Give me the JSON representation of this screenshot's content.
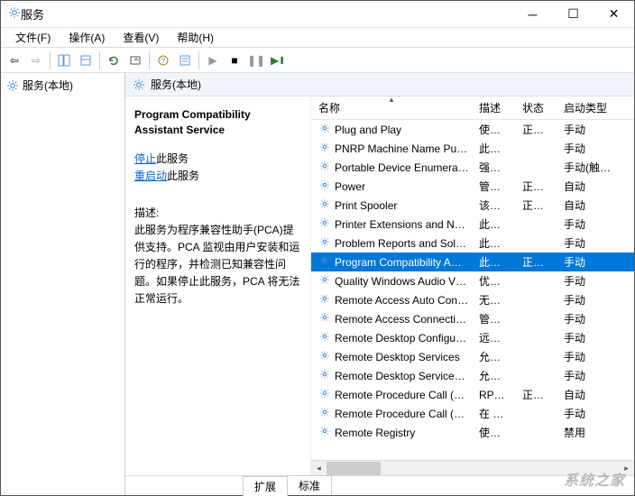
{
  "window": {
    "title": "服务"
  },
  "menu": {
    "file": "文件(F)",
    "action": "操作(A)",
    "view": "查看(V)",
    "help": "帮助(H)"
  },
  "tree": {
    "root": "服务(本地)"
  },
  "right_header": "服务(本地)",
  "detail": {
    "title": "Program Compatibility Assistant Service",
    "stop_link": "停止",
    "stop_suffix": "此服务",
    "restart_link": "重启动",
    "restart_suffix": "此服务",
    "desc_label": "描述:",
    "desc": "此服务为程序兼容性助手(PCA)提供支持。PCA 监视由用户安装和运行的程序，并检测已知兼容性问题。如果停止此服务，PCA 将无法正常运行。"
  },
  "columns": {
    "name": "名称",
    "desc": "描述",
    "status": "状态",
    "startup": "启动类型"
  },
  "rows": [
    {
      "name": "Plug and Play",
      "desc": "使计…",
      "status": "正在…",
      "startup": "手动",
      "selected": false
    },
    {
      "name": "PNRP Machine Name Pu…",
      "desc": "此服…",
      "status": "",
      "startup": "手动",
      "selected": false
    },
    {
      "name": "Portable Device Enumera…",
      "desc": "强制…",
      "status": "",
      "startup": "手动(触发…",
      "selected": false
    },
    {
      "name": "Power",
      "desc": "管理…",
      "status": "正在…",
      "startup": "自动",
      "selected": false
    },
    {
      "name": "Print Spooler",
      "desc": "该服…",
      "status": "正在…",
      "startup": "自动",
      "selected": false
    },
    {
      "name": "Printer Extensions and N…",
      "desc": "此服…",
      "status": "",
      "startup": "手动",
      "selected": false
    },
    {
      "name": "Problem Reports and Sol…",
      "desc": "此服…",
      "status": "",
      "startup": "手动",
      "selected": false
    },
    {
      "name": "Program Compatibility A…",
      "desc": "此服…",
      "status": "正在…",
      "startup": "手动",
      "selected": true
    },
    {
      "name": "Quality Windows Audio V…",
      "desc": "优质…",
      "status": "",
      "startup": "手动",
      "selected": false
    },
    {
      "name": "Remote Access Auto Con…",
      "desc": "无论…",
      "status": "",
      "startup": "手动",
      "selected": false
    },
    {
      "name": "Remote Access Connecti…",
      "desc": "管理…",
      "status": "",
      "startup": "手动",
      "selected": false
    },
    {
      "name": "Remote Desktop Configu…",
      "desc": "远程…",
      "status": "",
      "startup": "手动",
      "selected": false
    },
    {
      "name": "Remote Desktop Services",
      "desc": "允许…",
      "status": "",
      "startup": "手动",
      "selected": false
    },
    {
      "name": "Remote Desktop Service…",
      "desc": "允许…",
      "status": "",
      "startup": "手动",
      "selected": false
    },
    {
      "name": "Remote Procedure Call (…",
      "desc": "RPC…",
      "status": "正在…",
      "startup": "自动",
      "selected": false
    },
    {
      "name": "Remote Procedure Call (…",
      "desc": "在 W…",
      "status": "",
      "startup": "手动",
      "selected": false
    },
    {
      "name": "Remote Registry",
      "desc": "使远…",
      "status": "",
      "startup": "禁用",
      "selected": false
    }
  ],
  "tabs": {
    "extended": "扩展",
    "standard": "标准"
  },
  "watermark": "系统之家"
}
